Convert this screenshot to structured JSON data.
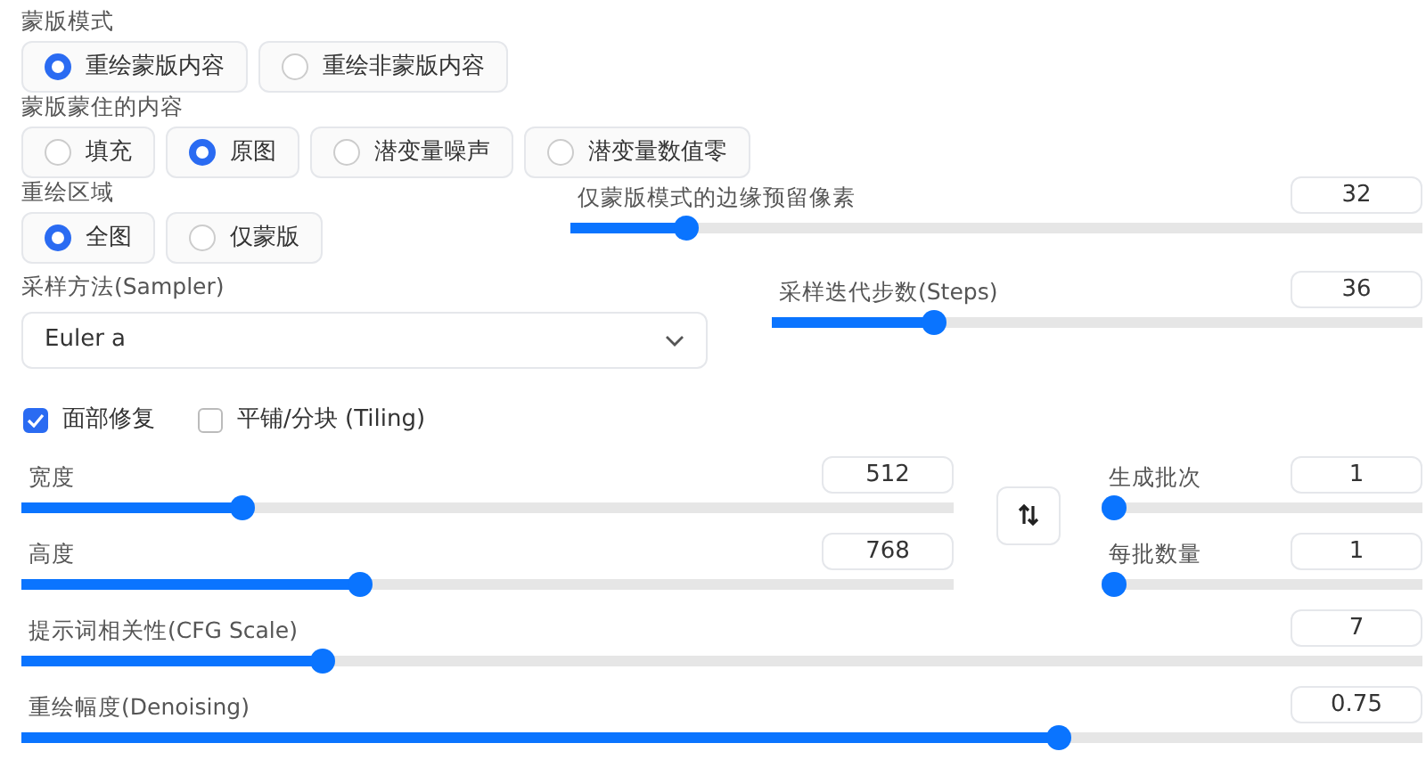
{
  "mask_mode": {
    "label": "蒙版模式",
    "options": [
      {
        "label": "重绘蒙版内容",
        "selected": true
      },
      {
        "label": "重绘非蒙版内容",
        "selected": false
      }
    ]
  },
  "masked_content": {
    "label": "蒙版蒙住的内容",
    "options": [
      {
        "label": "填充",
        "selected": false
      },
      {
        "label": "原图",
        "selected": true
      },
      {
        "label": "潜变量噪声",
        "selected": false
      },
      {
        "label": "潜变量数值零",
        "selected": false
      }
    ]
  },
  "inpaint_area": {
    "label": "重绘区域",
    "options": [
      {
        "label": "全图",
        "selected": true
      },
      {
        "label": "仅蒙版",
        "selected": false
      }
    ]
  },
  "mask_padding": {
    "label": "仅蒙版模式的边缘预留像素",
    "value": "32",
    "level": 0.125
  },
  "sampler": {
    "label": "采样方法(Sampler)",
    "value": "Euler a"
  },
  "steps": {
    "label": "采样迭代步数(Steps)",
    "value": "36",
    "level": 0.24
  },
  "checkboxes": [
    {
      "label": "面部修复",
      "checked": true
    },
    {
      "label": "平铺/分块 (Tiling)",
      "checked": false
    }
  ],
  "width": {
    "label": "宽度",
    "value": "512",
    "level": 0.23
  },
  "height": {
    "label": "高度",
    "value": "768",
    "level": 0.36
  },
  "batch_count": {
    "label": "生成批次",
    "value": "1",
    "level": 0
  },
  "batch_size": {
    "label": "每批数量",
    "value": "1",
    "level": 0
  },
  "cfg_scale": {
    "label": "提示词相关性(CFG Scale)",
    "value": "7",
    "level": 0.21
  },
  "denoising": {
    "label": "重绘幅度(Denoising)",
    "value": "0.75",
    "level": 0.745
  }
}
